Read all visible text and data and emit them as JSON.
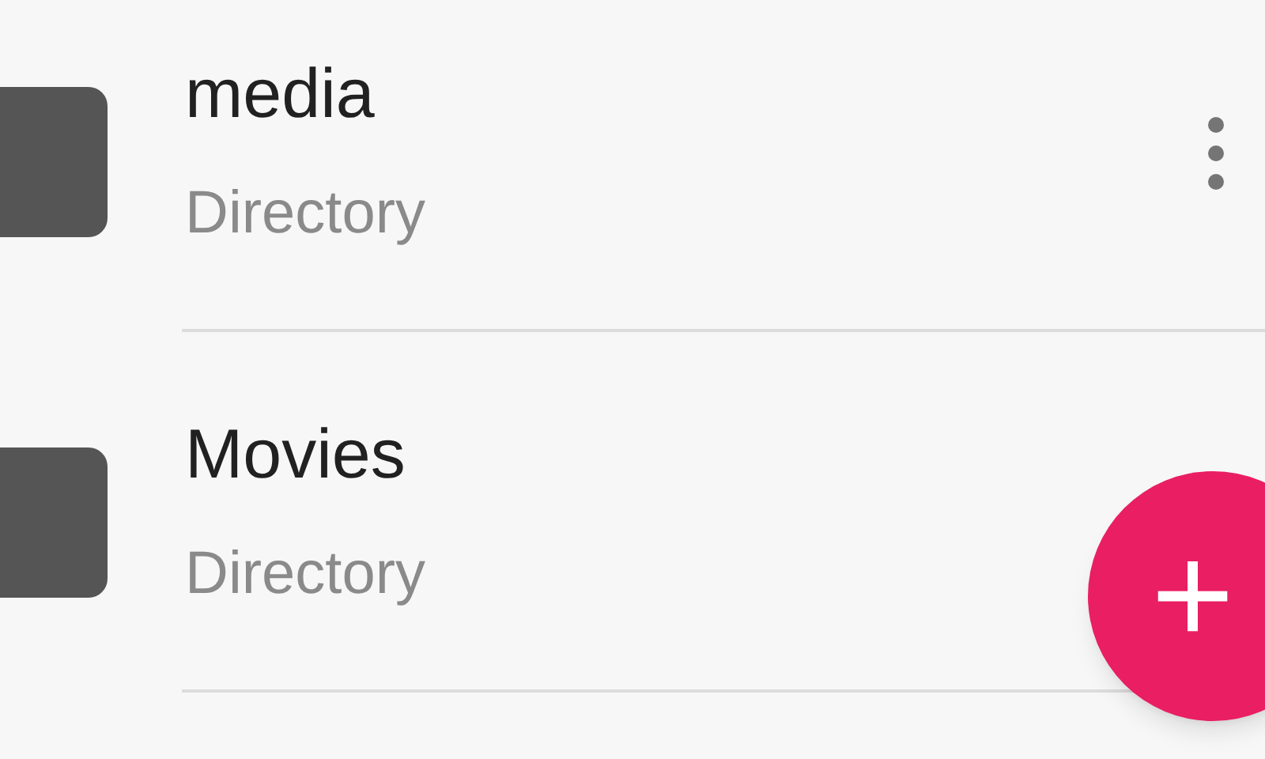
{
  "items": [
    {
      "title": "media",
      "subtitle": "Directory",
      "actions": [
        {
          "kind": "more"
        }
      ]
    },
    {
      "title": "Movies",
      "subtitle": "Directory"
    }
  ],
  "fab": {
    "label": "+"
  }
}
